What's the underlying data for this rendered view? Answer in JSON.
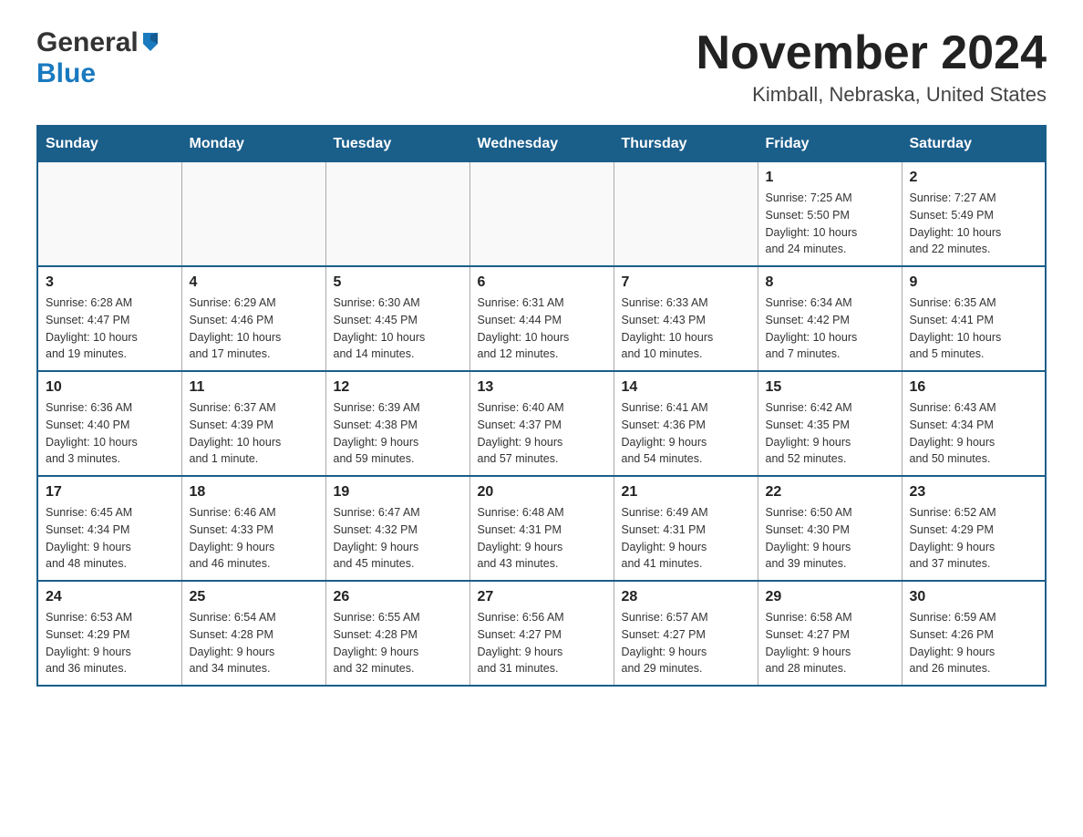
{
  "header": {
    "logo_general": "General",
    "logo_blue": "Blue",
    "month_title": "November 2024",
    "location": "Kimball, Nebraska, United States"
  },
  "days_of_week": [
    "Sunday",
    "Monday",
    "Tuesday",
    "Wednesday",
    "Thursday",
    "Friday",
    "Saturday"
  ],
  "weeks": [
    [
      {
        "day": "",
        "info": ""
      },
      {
        "day": "",
        "info": ""
      },
      {
        "day": "",
        "info": ""
      },
      {
        "day": "",
        "info": ""
      },
      {
        "day": "",
        "info": ""
      },
      {
        "day": "1",
        "info": "Sunrise: 7:25 AM\nSunset: 5:50 PM\nDaylight: 10 hours\nand 24 minutes."
      },
      {
        "day": "2",
        "info": "Sunrise: 7:27 AM\nSunset: 5:49 PM\nDaylight: 10 hours\nand 22 minutes."
      }
    ],
    [
      {
        "day": "3",
        "info": "Sunrise: 6:28 AM\nSunset: 4:47 PM\nDaylight: 10 hours\nand 19 minutes."
      },
      {
        "day": "4",
        "info": "Sunrise: 6:29 AM\nSunset: 4:46 PM\nDaylight: 10 hours\nand 17 minutes."
      },
      {
        "day": "5",
        "info": "Sunrise: 6:30 AM\nSunset: 4:45 PM\nDaylight: 10 hours\nand 14 minutes."
      },
      {
        "day": "6",
        "info": "Sunrise: 6:31 AM\nSunset: 4:44 PM\nDaylight: 10 hours\nand 12 minutes."
      },
      {
        "day": "7",
        "info": "Sunrise: 6:33 AM\nSunset: 4:43 PM\nDaylight: 10 hours\nand 10 minutes."
      },
      {
        "day": "8",
        "info": "Sunrise: 6:34 AM\nSunset: 4:42 PM\nDaylight: 10 hours\nand 7 minutes."
      },
      {
        "day": "9",
        "info": "Sunrise: 6:35 AM\nSunset: 4:41 PM\nDaylight: 10 hours\nand 5 minutes."
      }
    ],
    [
      {
        "day": "10",
        "info": "Sunrise: 6:36 AM\nSunset: 4:40 PM\nDaylight: 10 hours\nand 3 minutes."
      },
      {
        "day": "11",
        "info": "Sunrise: 6:37 AM\nSunset: 4:39 PM\nDaylight: 10 hours\nand 1 minute."
      },
      {
        "day": "12",
        "info": "Sunrise: 6:39 AM\nSunset: 4:38 PM\nDaylight: 9 hours\nand 59 minutes."
      },
      {
        "day": "13",
        "info": "Sunrise: 6:40 AM\nSunset: 4:37 PM\nDaylight: 9 hours\nand 57 minutes."
      },
      {
        "day": "14",
        "info": "Sunrise: 6:41 AM\nSunset: 4:36 PM\nDaylight: 9 hours\nand 54 minutes."
      },
      {
        "day": "15",
        "info": "Sunrise: 6:42 AM\nSunset: 4:35 PM\nDaylight: 9 hours\nand 52 minutes."
      },
      {
        "day": "16",
        "info": "Sunrise: 6:43 AM\nSunset: 4:34 PM\nDaylight: 9 hours\nand 50 minutes."
      }
    ],
    [
      {
        "day": "17",
        "info": "Sunrise: 6:45 AM\nSunset: 4:34 PM\nDaylight: 9 hours\nand 48 minutes."
      },
      {
        "day": "18",
        "info": "Sunrise: 6:46 AM\nSunset: 4:33 PM\nDaylight: 9 hours\nand 46 minutes."
      },
      {
        "day": "19",
        "info": "Sunrise: 6:47 AM\nSunset: 4:32 PM\nDaylight: 9 hours\nand 45 minutes."
      },
      {
        "day": "20",
        "info": "Sunrise: 6:48 AM\nSunset: 4:31 PM\nDaylight: 9 hours\nand 43 minutes."
      },
      {
        "day": "21",
        "info": "Sunrise: 6:49 AM\nSunset: 4:31 PM\nDaylight: 9 hours\nand 41 minutes."
      },
      {
        "day": "22",
        "info": "Sunrise: 6:50 AM\nSunset: 4:30 PM\nDaylight: 9 hours\nand 39 minutes."
      },
      {
        "day": "23",
        "info": "Sunrise: 6:52 AM\nSunset: 4:29 PM\nDaylight: 9 hours\nand 37 minutes."
      }
    ],
    [
      {
        "day": "24",
        "info": "Sunrise: 6:53 AM\nSunset: 4:29 PM\nDaylight: 9 hours\nand 36 minutes."
      },
      {
        "day": "25",
        "info": "Sunrise: 6:54 AM\nSunset: 4:28 PM\nDaylight: 9 hours\nand 34 minutes."
      },
      {
        "day": "26",
        "info": "Sunrise: 6:55 AM\nSunset: 4:28 PM\nDaylight: 9 hours\nand 32 minutes."
      },
      {
        "day": "27",
        "info": "Sunrise: 6:56 AM\nSunset: 4:27 PM\nDaylight: 9 hours\nand 31 minutes."
      },
      {
        "day": "28",
        "info": "Sunrise: 6:57 AM\nSunset: 4:27 PM\nDaylight: 9 hours\nand 29 minutes."
      },
      {
        "day": "29",
        "info": "Sunrise: 6:58 AM\nSunset: 4:27 PM\nDaylight: 9 hours\nand 28 minutes."
      },
      {
        "day": "30",
        "info": "Sunrise: 6:59 AM\nSunset: 4:26 PM\nDaylight: 9 hours\nand 26 minutes."
      }
    ]
  ]
}
